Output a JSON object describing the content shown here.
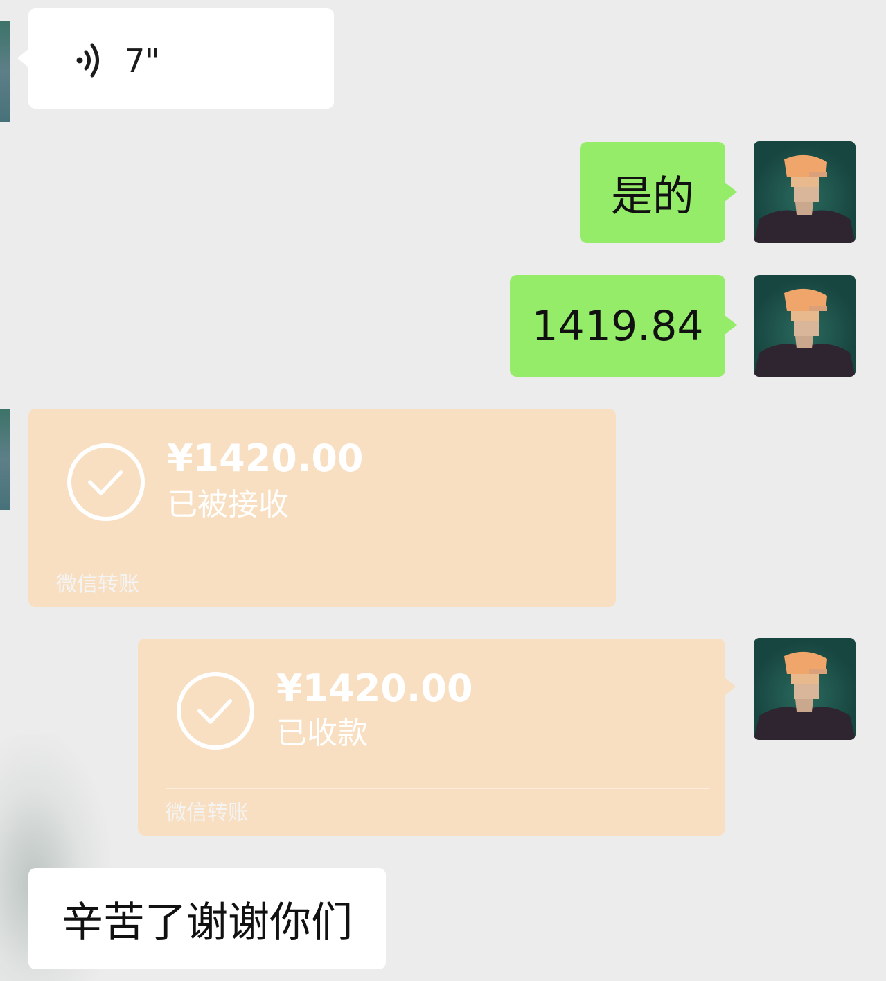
{
  "chat": {
    "voice_message": {
      "icon": "voice-wave-icon",
      "duration": "7\""
    },
    "sent_text_1": "是的",
    "sent_text_2": "1419.84",
    "transfer_received": {
      "amount": "¥1420.00",
      "status": "已被接收",
      "footer": "微信转账",
      "icon": "check-circle-icon"
    },
    "transfer_sent": {
      "amount": "¥1420.00",
      "status": "已收款",
      "footer": "微信转账",
      "icon": "check-circle-icon"
    },
    "received_text": "辛苦了谢谢你们"
  },
  "colors": {
    "background": "#ececec",
    "incoming_bubble": "#ffffff",
    "outgoing_bubble": "#95ec69",
    "transfer_card": "#f9dfc1"
  }
}
